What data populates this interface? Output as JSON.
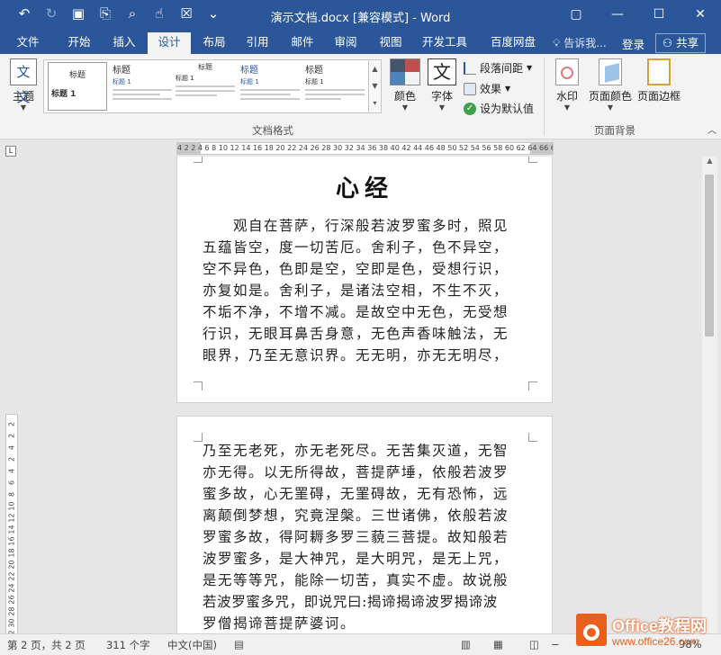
{
  "app": {
    "title": "演示文档.docx [兼容模式] - Word",
    "accent": "#2b579a"
  },
  "qat": [
    {
      "icon": "undo-icon",
      "glyph": "↶"
    },
    {
      "icon": "redo-icon",
      "glyph": "↻"
    },
    {
      "icon": "save-icon",
      "glyph": "▣"
    },
    {
      "icon": "format-painter-icon",
      "glyph": "⎘"
    },
    {
      "icon": "print-preview-icon",
      "glyph": "⌕"
    },
    {
      "icon": "touch-mode-icon",
      "glyph": "☝"
    },
    {
      "icon": "text-box-icon",
      "glyph": "☒"
    },
    {
      "icon": "customize-qat-icon",
      "glyph": "⌄"
    }
  ],
  "window": {
    "restore_icon": "▢",
    "minimize": "—",
    "maximize": "☐",
    "close": "✕"
  },
  "tabs": [
    "文件",
    "开始",
    "插入",
    "设计",
    "布局",
    "引用",
    "邮件",
    "审阅",
    "视图",
    "开发工具",
    "百度网盘"
  ],
  "active_tab": "设计",
  "tell_me": "告诉我...",
  "login": "登录",
  "share": "共享",
  "ribbon": {
    "theme_label": "主题",
    "theme_icon_text": "文文",
    "gallery_items": [
      {
        "heading": "标题",
        "sub": "标题 1"
      },
      {
        "heading": "标题",
        "sub": "标题 1"
      },
      {
        "heading": "标题",
        "sub": "标题 1"
      },
      {
        "heading": "标题",
        "sub": "标题 1"
      },
      {
        "heading": "标题",
        "sub": "标题 1"
      }
    ],
    "colors_label": "颜色",
    "fonts_label": "字体",
    "font_icon_text": "文",
    "paragraph_spacing": "段落间距",
    "effects": "效果",
    "set_default": "设为默认值",
    "group_doc_format": "文档格式",
    "watermark": "水印",
    "page_color": "页面颜色",
    "page_borders": "页面边框",
    "group_page_background": "页面背景"
  },
  "ruler": {
    "h_text": "4 2    2  4  6  8 10 12 14 16 18 20 22 24 26 28 30 32 34 36 38 40 42 44 46 48 50 52 54 56 58 60 62 64 66 68    72 74",
    "v_numbers": [
      "2",
      "2",
      "4",
      "2",
      "4",
      "6",
      "8",
      "10",
      "12",
      "14",
      "16",
      "18",
      "20",
      "22",
      "24",
      "26",
      "28",
      "30",
      "32"
    ]
  },
  "document": {
    "title": "心经",
    "page1_lines": [
      "　　观自在菩萨，行深般若波罗蜜多时，照见",
      "五蕴皆空，度一切苦厄。舍利子，色不异空，",
      "空不异色，色即是空，空即是色，受想行识，",
      "亦复如是。舍利子，是诸法空相，不生不灭，",
      "不垢不净，不增不减。是故空中无色，无受想",
      "行识，无眼耳鼻舌身意，无色声香味触法，无",
      "眼界，乃至无意识界。无无明，亦无无明尽，"
    ],
    "page2_lines": [
      "乃至无老死，亦无老死尽。无苦集灭道，无智",
      "亦无得。以无所得故，菩提萨埵，依般若波罗",
      "蜜多故，心无罣碍，无罣碍故，无有恐怖，远",
      "离颠倒梦想，究竟涅槃。三世诸佛，依般若波",
      "罗蜜多故，得阿耨多罗三藐三菩提。故知般若",
      "波罗蜜多，是大神咒，是大明咒，是无上咒，",
      "是无等等咒，能除一切苦，真实不虚。故说般",
      "若波罗蜜多咒，即说咒曰:揭谛揭谛波罗揭谛波",
      "罗僧揭谛菩提萨婆诃。"
    ]
  },
  "status": {
    "page": "第 2 页，共 2 页",
    "words": "311 个字",
    "lang": "中文(中国)",
    "zoom": "98%"
  },
  "watermark_logo": {
    "line1": "Office教程网",
    "line2": "www.office26.com"
  }
}
